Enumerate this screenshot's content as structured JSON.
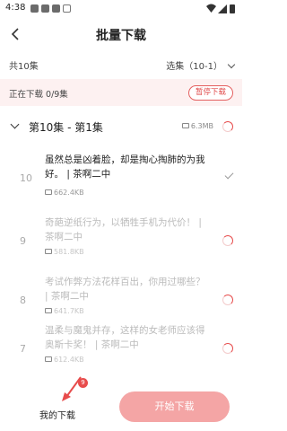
{
  "status_bar": {
    "time": "4:38"
  },
  "header": {
    "title": "批量下载"
  },
  "summary": {
    "total": "共10集",
    "range": "选集（10-1）"
  },
  "banner": {
    "text": "正在下载 0/9集",
    "pause_label": "暂停下载"
  },
  "chapter": {
    "name": "第10集 - 第1集",
    "size": "6.3MB"
  },
  "items": [
    {
      "num": "10",
      "text": "虽然总是凶着脸，却是掏心掏肺的为我好。 | 茶啊二中",
      "size": "662.4KB",
      "state": "done"
    },
    {
      "num": "9",
      "text": "奇葩逆纸行为，以牺牲手机为代价！ | 茶啊二中",
      "size": "581.8KB",
      "state": "downloading"
    },
    {
      "num": "8",
      "text": "考试作弊方法花样百出，你用过哪些？ | 茶啊二中",
      "size": "641.7KB",
      "state": "downloading"
    },
    {
      "num": "7",
      "text": "温柔与魔鬼并存，这样的女老师应该得奥斯卡奖！ | 茶啊二中",
      "size": "612.4KB",
      "state": "downloading"
    }
  ],
  "bottom": {
    "my_downloads": "我的下载",
    "badge": "9",
    "start_label": "开始下载"
  },
  "colors": {
    "accent": "#e74c4c",
    "banner_bg": "#fdf1f1"
  }
}
